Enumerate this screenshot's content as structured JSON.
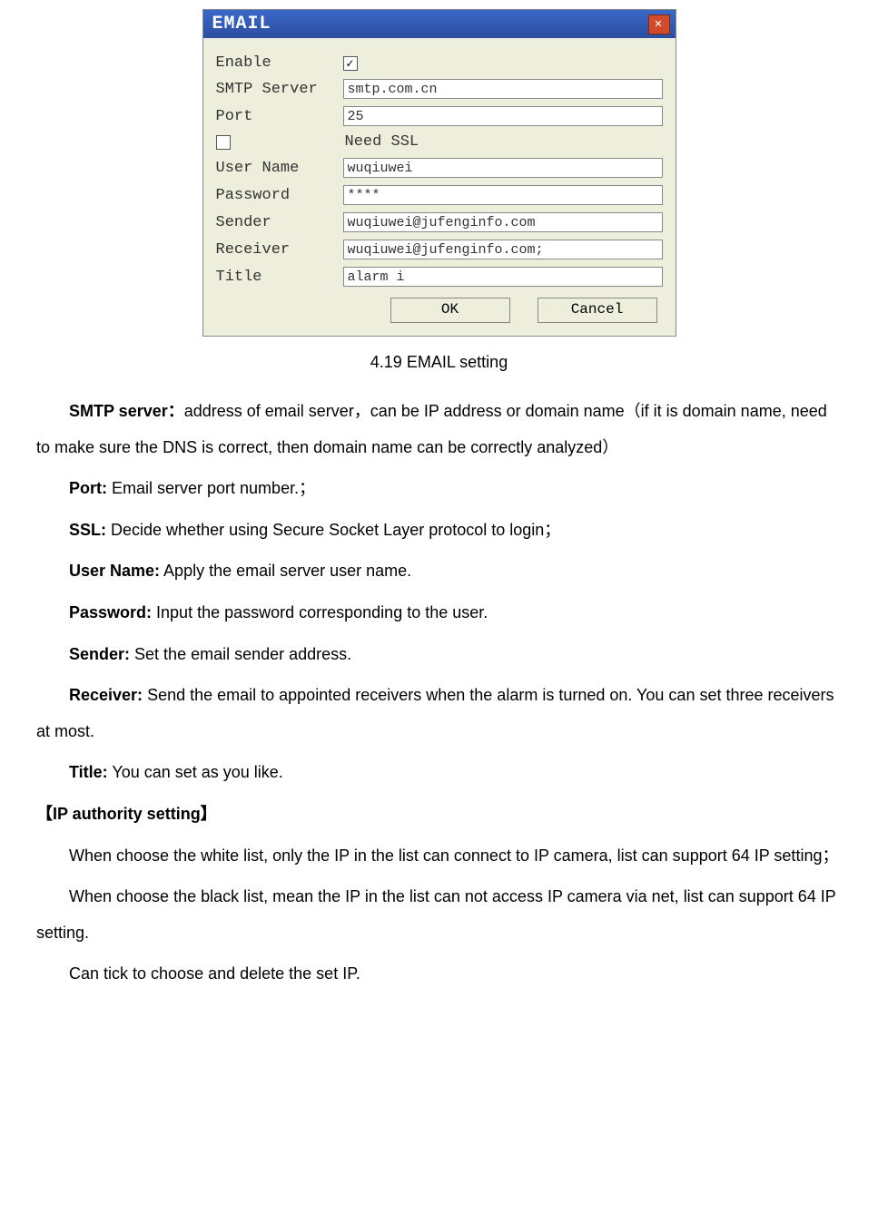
{
  "dialog": {
    "title": "EMAIL",
    "close_glyph": "✕",
    "labels": {
      "enable": "Enable",
      "smtp_server": "SMTP Server",
      "port": "Port",
      "need_ssl": "Need SSL",
      "user_name": "User Name",
      "password": "Password",
      "sender": "Sender",
      "receiver": "Receiver",
      "title": "Title"
    },
    "values": {
      "enable_checked": "✓",
      "smtp_server": "smtp.com.cn",
      "port": "25",
      "ssl_checked": "",
      "user_name": "wuqiuwei",
      "password": "****",
      "sender": "wuqiuwei@jufenginfo.com",
      "receiver": "wuqiuwei@jufenginfo.com;",
      "title": "alarm i"
    },
    "buttons": {
      "ok": "OK",
      "cancel": "Cancel"
    }
  },
  "caption": "4.19 EMAIL setting",
  "doc": {
    "smtp_b": "SMTP server：",
    "smtp_t": "address of email server，can be IP address or domain name（if it is domain name, need to make sure the DNS is correct, then domain name can be correctly analyzed）",
    "port_b": "Port:",
    "port_t": " Email server port number.；",
    "ssl_b": "SSL:",
    "ssl_t": " Decide whether using Secure Socket Layer protocol to login；",
    "user_b": "User Name:",
    "user_t": " Apply the email server user name.",
    "pass_b": "Password:",
    "pass_t": " Input the password corresponding to the user.",
    "send_b": "Sender:",
    "send_t": " Set the email sender address.",
    "recv_b": "Receiver:",
    "recv_t": " Send the email to appointed receivers when the alarm is turned on. You can set three receivers at most.",
    "title_b": "Title:",
    "title_t": " You can set as you like.",
    "ip_heading": "【IP authority setting】",
    "ip_p1": "When choose the white list, only the IP in the list can connect to IP camera, list can support 64 IP setting；",
    "ip_p2": "When choose the black list, mean the IP in the list can not access IP camera via net, list can support 64 IP setting.",
    "ip_p3": "Can tick to choose and delete the set IP."
  }
}
